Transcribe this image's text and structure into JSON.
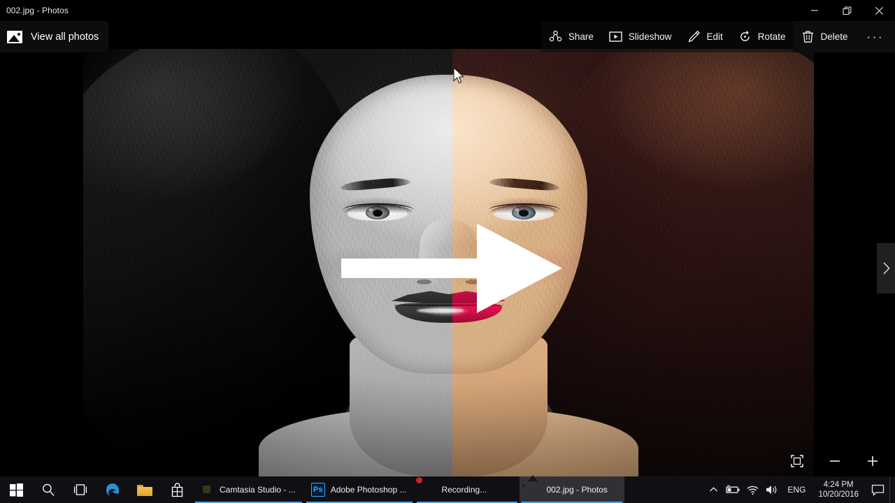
{
  "window": {
    "title": "002.jpg - Photos",
    "controls": {
      "minimize": "Minimize",
      "restore": "Restore",
      "close": "Close"
    }
  },
  "toolbar": {
    "view_all_label": "View all photos",
    "items": [
      {
        "label": "Share",
        "icon": "share-icon"
      },
      {
        "label": "Slideshow",
        "icon": "slideshow-icon"
      },
      {
        "label": "Edit",
        "icon": "pencil-icon"
      },
      {
        "label": "Rotate",
        "icon": "rotate-icon"
      },
      {
        "label": "Delete",
        "icon": "trash-icon"
      }
    ],
    "more_label": "···"
  },
  "viewer": {
    "photo_description": "Before-and-after portrait: left half desaturated black-and-white, right half colorized with auburn hair and crimson lips, joined by a large white right-pointing arrow.",
    "zoom_controls": {
      "fit_label": "Fit to window",
      "zoom_out_label": "−",
      "zoom_in_label": "+"
    },
    "next_label": "Next"
  },
  "taskbar": {
    "system_icons": [
      {
        "name": "start-button",
        "label": "Start"
      },
      {
        "name": "search-button",
        "label": "Search"
      },
      {
        "name": "task-view-button",
        "label": "Task View"
      },
      {
        "name": "edge-button",
        "label": "Microsoft Edge"
      },
      {
        "name": "file-explorer-button",
        "label": "File Explorer"
      },
      {
        "name": "store-button",
        "label": "Microsoft Store"
      }
    ],
    "apps": [
      {
        "label": "Camtasia Studio - ...",
        "icon": "camtasia-icon",
        "active": false
      },
      {
        "label": "Adobe Photoshop ...",
        "icon": "photoshop-icon",
        "active": false
      },
      {
        "label": "Recording...",
        "icon": "recording-icon",
        "active": false
      },
      {
        "label": "002.jpg - Photos",
        "icon": "photos-icon",
        "active": true
      }
    ],
    "tray": {
      "chevron": "⌃",
      "battery": "battery-icon",
      "network": "wifi-icon",
      "volume": "volume-icon",
      "language": "ENG",
      "time": "4:24 PM",
      "date": "10/20/2016",
      "action_center": "action-center-icon"
    }
  }
}
